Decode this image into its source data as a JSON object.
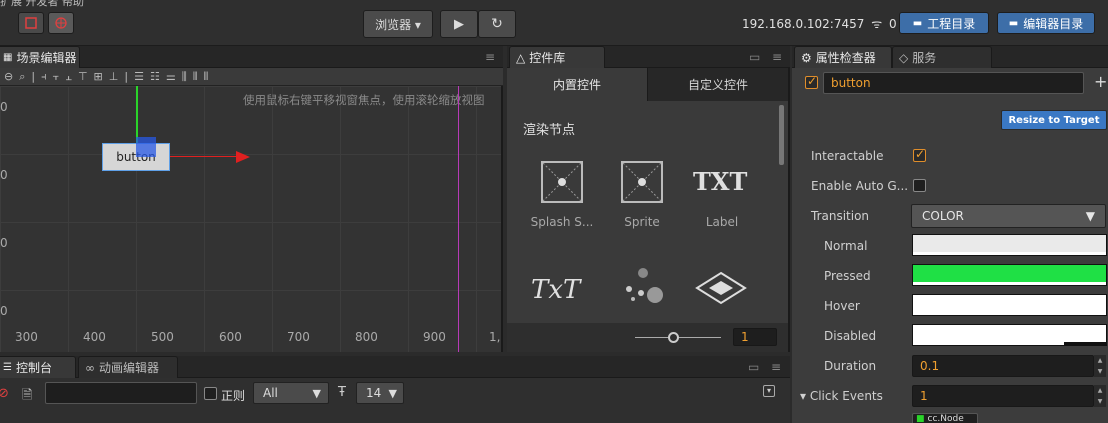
{
  "top": {
    "menu_fragment": "扩展   开发者   帮助",
    "browser_label": "浏览器 ▾",
    "play_icon": "play-icon",
    "refresh_icon": "refresh-icon",
    "ip": "192.168.0.102:7457",
    "wifi_count": "0",
    "project_dir_label": "工程目录",
    "editor_dir_label": "编辑器目录"
  },
  "scene": {
    "tab_label": "场景编辑器",
    "hint": "使用鼠标右键平移视窗焦点，使用滚轮缩放视图",
    "node_label": "button",
    "ruler_x": [
      "300",
      "400",
      "500",
      "600",
      "700",
      "800",
      "900",
      "1,"
    ],
    "ruler_y": [
      "0",
      "0",
      "0",
      "0"
    ]
  },
  "library": {
    "tab_label": "控件库",
    "subtabs": [
      "内置控件",
      "自定义控件"
    ],
    "section": "渲染节点",
    "items": [
      "Splash S...",
      "Sprite",
      "Label"
    ],
    "row2_glyphs": [
      "TxT",
      "",
      ""
    ],
    "label_glyph": "TXT",
    "zoom_value": "1"
  },
  "inspector": {
    "tab_label": "属性检查器",
    "tab2_label": "服务",
    "node_name": "button",
    "resize_label": "Resize to Target",
    "props": {
      "interactable": "Interactable",
      "auto_gray": "Enable Auto G...",
      "transition": "Transition",
      "transition_value": "COLOR",
      "normal": "Normal",
      "pressed": "Pressed",
      "hover": "Hover",
      "disabled": "Disabled",
      "duration": "Duration",
      "duration_value": "0.1",
      "click_events": "▾ Click Events",
      "click_events_value": "1",
      "cc_node": "cc.Node"
    },
    "colors": {
      "normal": "#eaeaea",
      "pressed": "#1fe045",
      "hover": "#ffffff",
      "disabled": "#ffffff"
    }
  },
  "console": {
    "tab_label": "控制台",
    "tab2_label": "动画编辑器",
    "regex_label": "正则",
    "filter_value": "All",
    "font_size_value": "14"
  }
}
